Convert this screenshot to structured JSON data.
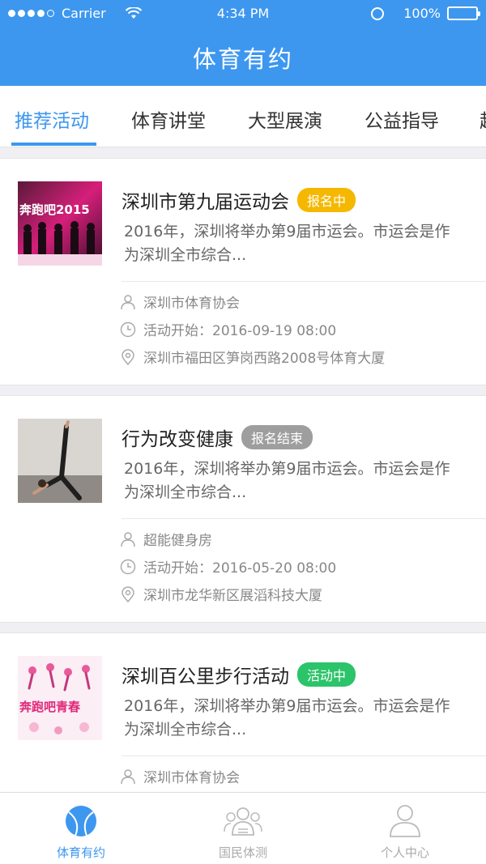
{
  "status_bar": {
    "carrier": "Carrier",
    "time": "4:34 PM",
    "battery": "100%"
  },
  "header": {
    "title": "体育有约",
    "color": "#3d97ef"
  },
  "tabs": [
    "推荐活动",
    "体育讲堂",
    "大型展演",
    "公益指导",
    "超"
  ],
  "active_tab": 0,
  "activities": [
    {
      "title": "深圳市第九届运动会",
      "badge": "报名中",
      "badge_color": "#f5b800",
      "description": "2016年，深圳将举办第9届市运会。市运会是作为深圳全市综合...",
      "organizer": "深圳市体育协会",
      "start_time": "活动开始：2016-09-19  08:00",
      "location": "深圳市福田区笋岗西路2008号体育大厦",
      "thumb_text": "奔跑吧2015"
    },
    {
      "title": "行为改变健康",
      "badge": "报名结束",
      "badge_color": "#9e9e9e",
      "description": "2016年，深圳将举办第9届市运会。市运会是作为深圳全市综合...",
      "organizer": "超能健身房",
      "start_time": "活动开始：2016-05-20  08:00",
      "location": "深圳市龙华新区展滔科技大厦",
      "thumb_text": ""
    },
    {
      "title": "深圳百公里步行活动",
      "badge": "活动中",
      "badge_color": "#2cc46a",
      "description": "2016年，深圳将举办第9届市运会。市运会是作为深圳全市综合...",
      "organizer": "深圳市体育协会",
      "thumb_text": "奔跑吧青春"
    }
  ],
  "tabbar": [
    {
      "label": "体育有约",
      "icon": "ball-icon",
      "active": true
    },
    {
      "label": "国民体测",
      "icon": "people-icon",
      "active": false
    },
    {
      "label": "个人中心",
      "icon": "person-icon",
      "active": false
    }
  ]
}
